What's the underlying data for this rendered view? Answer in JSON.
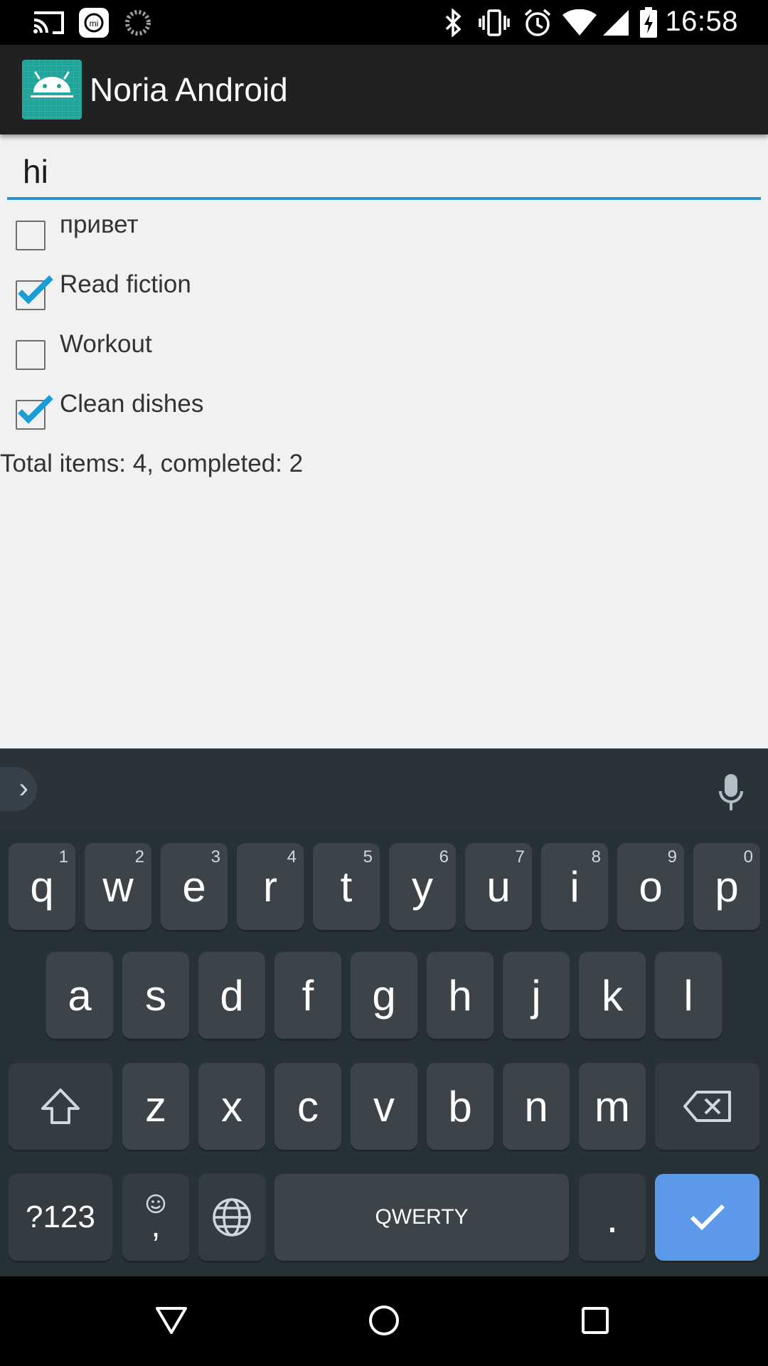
{
  "status_bar": {
    "time": "16:58",
    "icons": [
      "cast-icon",
      "mi-icon",
      "sync-icon",
      "bluetooth-icon",
      "vibrate-icon",
      "alarm-icon",
      "wifi-icon",
      "signal-icon",
      "battery-charging-icon"
    ]
  },
  "app_bar": {
    "title": "Noria Android",
    "icon": "android-icon"
  },
  "new_item_input": {
    "value": "hi"
  },
  "todo_items": [
    {
      "label": "привет",
      "checked": false
    },
    {
      "label": "Read fiction",
      "checked": true
    },
    {
      "label": "Workout",
      "checked": false
    },
    {
      "label": "Clean dishes",
      "checked": true
    }
  ],
  "summary": "Total items: 4, completed: 2",
  "keyboard": {
    "expand_icon": "chevron-right-icon",
    "mic_icon": "mic-icon",
    "row1": [
      {
        "label": "q",
        "hint": "1"
      },
      {
        "label": "w",
        "hint": "2"
      },
      {
        "label": "e",
        "hint": "3"
      },
      {
        "label": "r",
        "hint": "4"
      },
      {
        "label": "t",
        "hint": "5"
      },
      {
        "label": "y",
        "hint": "6"
      },
      {
        "label": "u",
        "hint": "7"
      },
      {
        "label": "i",
        "hint": "8"
      },
      {
        "label": "o",
        "hint": "9"
      },
      {
        "label": "p",
        "hint": "0"
      }
    ],
    "row2": [
      "a",
      "s",
      "d",
      "f",
      "g",
      "h",
      "j",
      "k",
      "l"
    ],
    "row3": [
      "z",
      "x",
      "c",
      "v",
      "b",
      "n",
      "m"
    ],
    "shift_icon": "shift-icon",
    "backspace_icon": "backspace-icon",
    "symbols_label": "?123",
    "emoji_comma_label": ",",
    "emoji_icon": "emoji-icon",
    "globe_icon": "globe-icon",
    "space_label": "QWERTY",
    "period_label": ".",
    "enter_icon": "check-icon",
    "enter_color": "#5c9ae9"
  },
  "nav_bar": {
    "back_icon": "back-triangle-icon",
    "home_icon": "home-circle-icon",
    "recents_icon": "recents-square-icon"
  },
  "colors": {
    "accent": "#2b94cc",
    "app_icon_bg": "#1fa59a",
    "keyboard_bg": "#263238"
  }
}
